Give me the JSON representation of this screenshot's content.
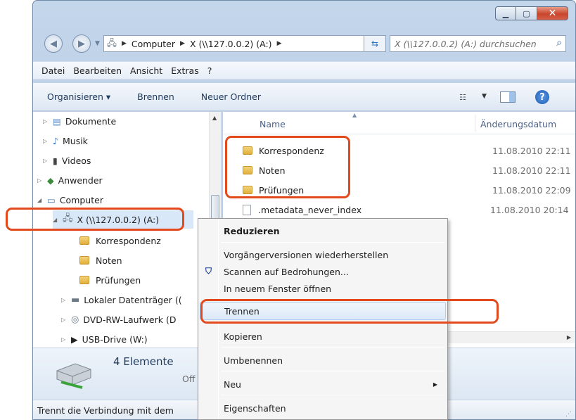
{
  "addressbar": {
    "crumbs": [
      "Computer",
      "X (\\\\127.0.0.2) (A:)"
    ],
    "search_placeholder": "X (\\\\127.0.0.2) (A:) durchsuchen"
  },
  "menubar": [
    "Datei",
    "Bearbeiten",
    "Ansicht",
    "Extras",
    "?"
  ],
  "commandbar": [
    "Organisieren ▾",
    "Brennen",
    "Neuer Ordner"
  ],
  "nav": {
    "items": [
      {
        "label": "Dokumente"
      },
      {
        "label": "Musik"
      },
      {
        "label": "Videos"
      },
      {
        "label": "Anwender"
      },
      {
        "label": "Computer"
      },
      {
        "label": "X (\\\\127.0.0.2) (A:)"
      },
      {
        "label": "Korrespondenz"
      },
      {
        "label": "Noten"
      },
      {
        "label": "Prüfungen"
      },
      {
        "label": "Lokaler Datenträger (("
      },
      {
        "label": "DVD-RW-Laufwerk (D"
      },
      {
        "label": "USB-Drive (W:)"
      }
    ]
  },
  "files": {
    "columns": {
      "name": "Name",
      "date": "Änderungsdatum"
    },
    "rows": [
      {
        "name": "Korrespondenz",
        "date": "11.08.2010 22:11"
      },
      {
        "name": "Noten",
        "date": "11.08.2010 22:11"
      },
      {
        "name": "Prüfungen",
        "date": "11.08.2010 22:09"
      },
      {
        "name": ".metadata_never_index",
        "date": "11.08.2010 20:14"
      }
    ]
  },
  "details": {
    "count": "4 Elemente",
    "state": "Off"
  },
  "status": "Trennt die Verbindung mit dem",
  "context_menu": {
    "items": [
      "Reduzieren",
      "Vorgängerversionen wiederherstellen",
      "Scannen auf Bedrohungen...",
      "In neuem Fenster öffnen",
      "Trennen",
      "Kopieren",
      "Umbenennen",
      "Neu",
      "Eigenschaften"
    ]
  },
  "colors": {
    "highlight": "#e24a1e",
    "accent": "#1e395b"
  }
}
